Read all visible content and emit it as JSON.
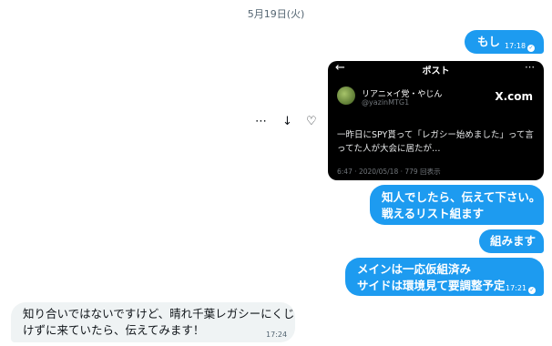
{
  "date_separator": "5月19日(火)",
  "messages": [
    {
      "text": "もし",
      "time": "17:18",
      "read": true
    },
    {
      "text_lines": [
        "知人でしたら、伝えて下さい。",
        "戦えるリスト組ます"
      ]
    },
    {
      "text": "組みます"
    },
    {
      "text_lines": [
        "メインは一応仮組済み",
        "サイドは環境見て要調整予定"
      ],
      "time": "17:21",
      "read": true
    },
    {
      "text_lines": [
        "知り合いではないですけど、晴れ千葉レガシーにくじ",
        "けずに来ていたら、伝えてみます！"
      ],
      "time": "17:24"
    }
  ],
  "shared_post": {
    "header_title": "ポスト",
    "author_name": "リアニ×イ党・やじん",
    "author_handle": "@yazinMTG1",
    "source": "X.com",
    "text_lines": [
      "一昨日にSPY貰って「レガシー始めました」って言",
      "ってた人が大会に居たが…"
    ],
    "timestamp": "6:47 · 2020/05/18 · 779 回表示"
  },
  "message_actions": [
    {
      "icon": "more-icon",
      "glyph": "⋯"
    },
    {
      "icon": "download-icon",
      "glyph": "↓"
    },
    {
      "icon": "react-heart-icon",
      "glyph": "♡"
    }
  ],
  "colors": {
    "outgoing_bubble": "#1d9bf0",
    "incoming_bubble": "#eff3f4",
    "card_bg": "#000000"
  }
}
